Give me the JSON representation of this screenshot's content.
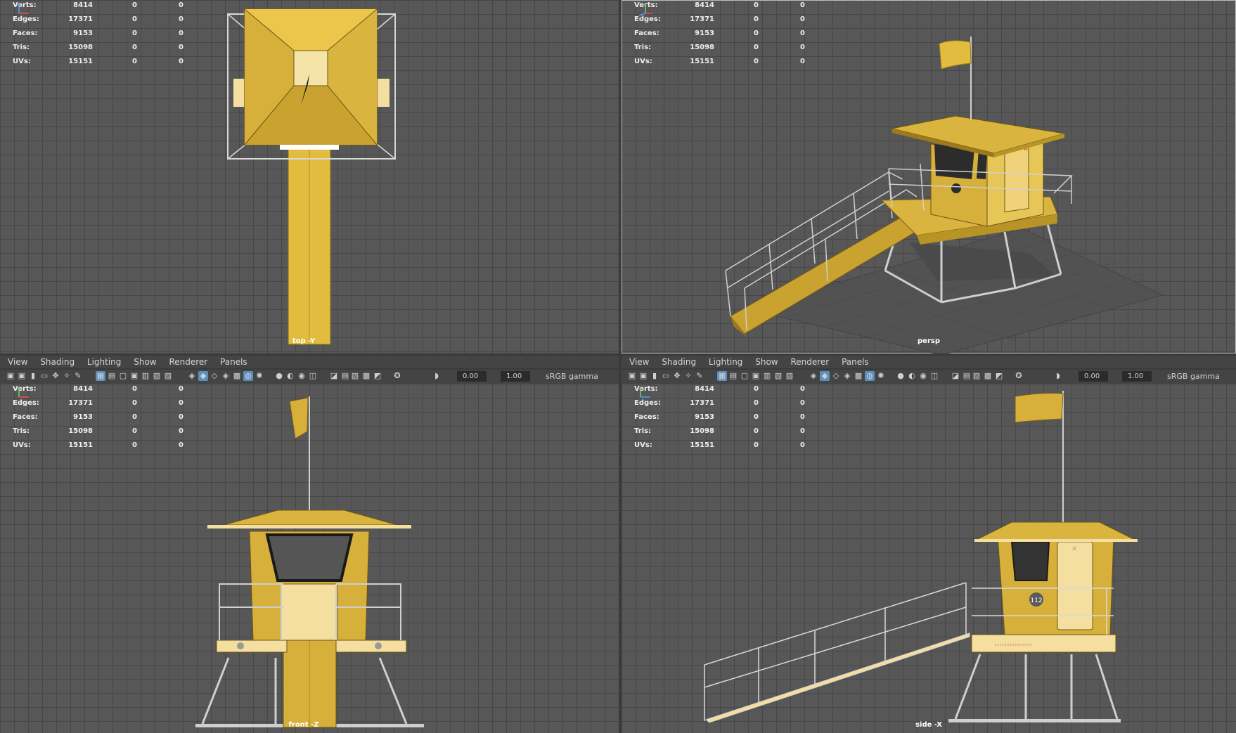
{
  "hud": {
    "rows": [
      {
        "label": "Verts:",
        "v1": "8414",
        "v2": "0",
        "v3": "0"
      },
      {
        "label": "Edges:",
        "v1": "17371",
        "v2": "0",
        "v3": "0"
      },
      {
        "label": "Faces:",
        "v1": "9153",
        "v2": "0",
        "v3": "0"
      },
      {
        "label": "Tris:",
        "v1": "15098",
        "v2": "0",
        "v3": "0"
      },
      {
        "label": "UVs:",
        "v1": "15151",
        "v2": "0",
        "v3": "0"
      }
    ]
  },
  "viewports": {
    "top": {
      "label": "top -Y"
    },
    "persp": {
      "label": "persp"
    },
    "front": {
      "label": "front -Z"
    },
    "side": {
      "label": "side -X"
    }
  },
  "menu": {
    "items": [
      "View",
      "Shading",
      "Lighting",
      "Show",
      "Renderer",
      "Panels"
    ]
  },
  "toolbar": {
    "exposure": "0.00",
    "gamma": "1.00",
    "colorspace": "sRGB gamma"
  },
  "model": {
    "lifeguard_badge": "112"
  },
  "colors": {
    "grid_bg": "#575757",
    "grid_line": "#474747",
    "panel_bg": "#444444",
    "hut_yellow": "#e2bc3e",
    "hut_shadow": "#b89326",
    "hut_cream": "#f4dfa0",
    "rail": "#c9c9c9",
    "window": "#333333",
    "highlight": "#5a8fc0"
  },
  "icons": [
    "camera-icon",
    "camera-attr-icon",
    "bookmark-icon",
    "image-plane-icon",
    "pan-icon",
    "move-tool-icon",
    "grease-pencil-icon",
    "grid-icon",
    "film-gate-icon",
    "resolution-gate-icon",
    "gate-mask-icon",
    "field-chart-icon",
    "safe-action-icon",
    "safe-title-icon",
    "wireframe-icon",
    "smooth-shade-icon",
    "default-material-icon",
    "wireframe-on-shaded-icon",
    "textured-icon",
    "xray-icon",
    "lights-icon",
    "shadows-icon",
    "ambient-occlusion-icon",
    "motion-blur-icon",
    "antialias-icon",
    "depth-of-field-icon",
    "isolate-select-icon",
    "xray-joints-icon",
    "xray-active-icon",
    "backface-icon",
    "exposure-icon",
    "gamma-icon",
    "colorspace-icon"
  ]
}
